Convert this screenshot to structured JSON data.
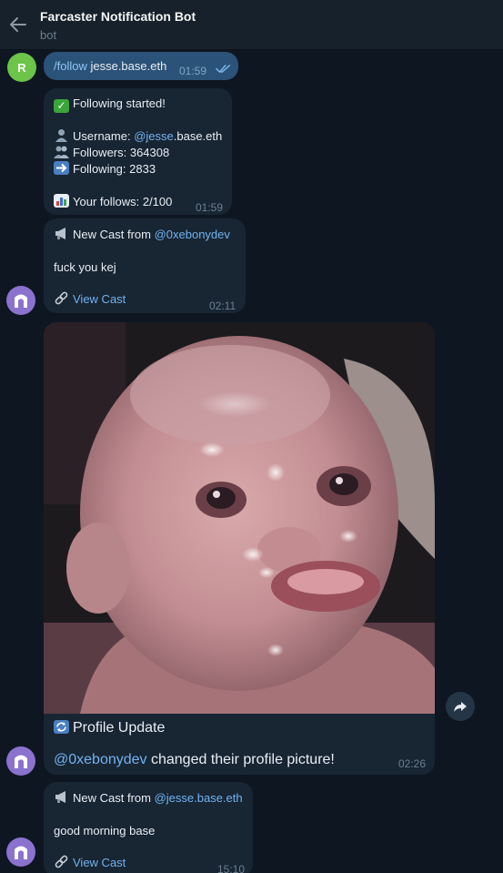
{
  "header": {
    "title": "Farcaster Notification Bot",
    "subtitle": "bot"
  },
  "user_avatar": {
    "letter": "R",
    "color": "#6cc449"
  },
  "messages": {
    "m1": {
      "command": "/follow",
      "arg": " jesse.base.eth",
      "time": "01:59",
      "status_icon": "double-check-icon"
    },
    "m2": {
      "title": "Following started!",
      "username_label": "Username: ",
      "username_link": "@jesse",
      "username_rest": ".base.eth",
      "followers": "Followers: 364308",
      "following": "Following: 2833",
      "your_follows": "Your follows: 2/100",
      "time": "01:59"
    },
    "m3": {
      "title_prefix": "New Cast from ",
      "author": "@0xebonydev",
      "text": "fuck you kej",
      "link": "View Cast",
      "time": "02:11"
    },
    "m4": {
      "title": "Profile Update",
      "handle": "@0xebonydev",
      "text": " changed their profile picture!",
      "time": "02:26"
    },
    "m5": {
      "title_prefix": "New Cast from ",
      "author": "@jesse.base.eth",
      "text": "good morning base",
      "link": "View Cast",
      "time": "15:10"
    }
  },
  "colors": {
    "background": "#0e1621",
    "header": "#17212b",
    "outgoing": "#2b5278",
    "incoming": "#182533",
    "link": "#71b3f0",
    "bot_avatar": "#8a72ce"
  }
}
